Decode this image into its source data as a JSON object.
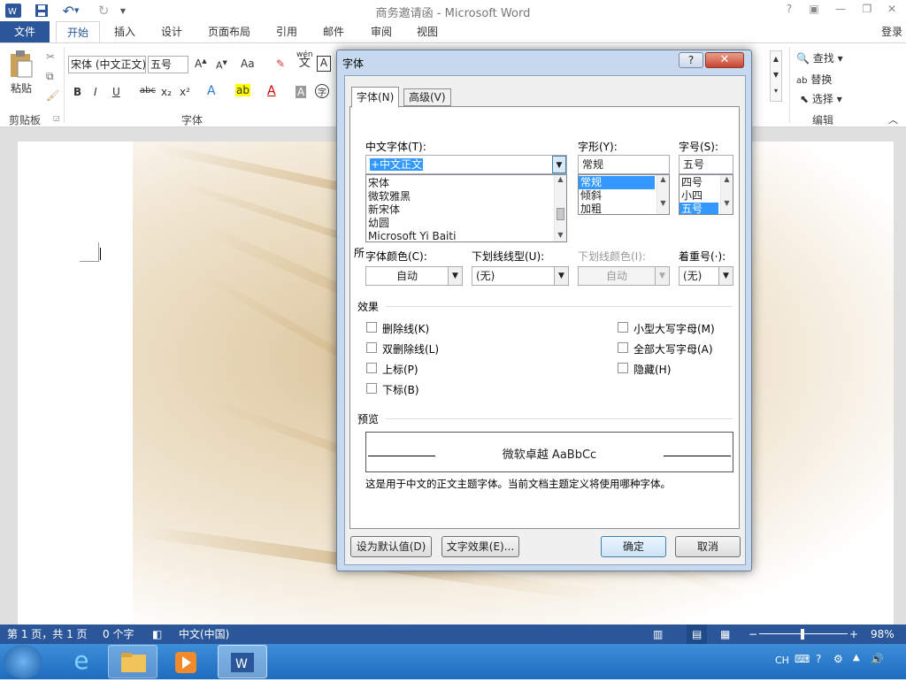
{
  "window": {
    "title": "商务邀请函 - Microsoft Word",
    "login": "登录",
    "help": "?"
  },
  "tabs": [
    "文件",
    "开始",
    "插入",
    "设计",
    "页面布局",
    "引用",
    "邮件",
    "审阅",
    "视图"
  ],
  "ribbon": {
    "paste_label": "粘贴",
    "font_name": "宋体 (中文正文)",
    "font_size": "五号",
    "groups": {
      "clipboard": "剪贴板",
      "font": "字体",
      "editing": "编辑"
    },
    "editing": {
      "find": "查找",
      "replace": "替换",
      "select": "选择"
    },
    "wen_label": "wén",
    "wen_char": "文",
    "font_buttons": [
      "A",
      "A",
      "Aa",
      "B",
      "I",
      "U",
      "abc",
      "x₂",
      "x²",
      "A",
      "A",
      "A",
      "A",
      "字"
    ]
  },
  "dialog": {
    "title": "字体",
    "tabs": {
      "font": "字体(N)",
      "advanced": "高级(V)"
    },
    "cn_font_label": "中文字体(T):",
    "cn_font_value": "+中文正文",
    "font_list": [
      "宋体",
      "微软雅黑",
      "新宋体",
      "幼圆",
      "Microsoft Yi Baiti"
    ],
    "hidden_label": "所",
    "style_label": "字形(Y):",
    "style_value": "常规",
    "style_list": [
      "常规",
      "倾斜",
      "加粗"
    ],
    "size_label": "字号(S):",
    "size_value": "五号",
    "size_list": [
      "四号",
      "小四",
      "五号"
    ],
    "color_label": "字体颜色(C):",
    "color_value": "自动",
    "underline_label": "下划线线型(U):",
    "underline_value": "(无)",
    "underline_color_label": "下划线颜色(I):",
    "underline_color_value": "自动",
    "emphasis_label": "着重号(·):",
    "emphasis_value": "(无)",
    "effects_label": "效果",
    "effects": [
      {
        "label": "删除线(K)",
        "checked": false
      },
      {
        "label": "双删除线(L)",
        "checked": false
      },
      {
        "label": "上标(P)",
        "checked": false
      },
      {
        "label": "下标(B)",
        "checked": false
      },
      {
        "label": "小型大写字母(M)",
        "checked": false
      },
      {
        "label": "全部大写字母(A)",
        "checked": false
      },
      {
        "label": "隐藏(H)",
        "checked": false
      }
    ],
    "preview_label": "预览",
    "preview_text": "微软卓越 AaBbCc",
    "preview_note": "这是用于中文的正文主题字体。当前文档主题定义将使用哪种字体。",
    "buttons": {
      "default": "设为默认值(D)",
      "text_effects": "文字效果(E)...",
      "ok": "确定",
      "cancel": "取消"
    }
  },
  "statusbar": {
    "page": "第 1 页，共 1 页",
    "words": "0 个字",
    "lang": "中文(中国)",
    "zoom": "98%",
    "zoom_level": 0.98
  },
  "taskbar": {
    "lang": "CH"
  },
  "colors": {
    "accent": "#2b579a",
    "taskbar": "#2a7bd0",
    "selection": "#3399ff"
  }
}
